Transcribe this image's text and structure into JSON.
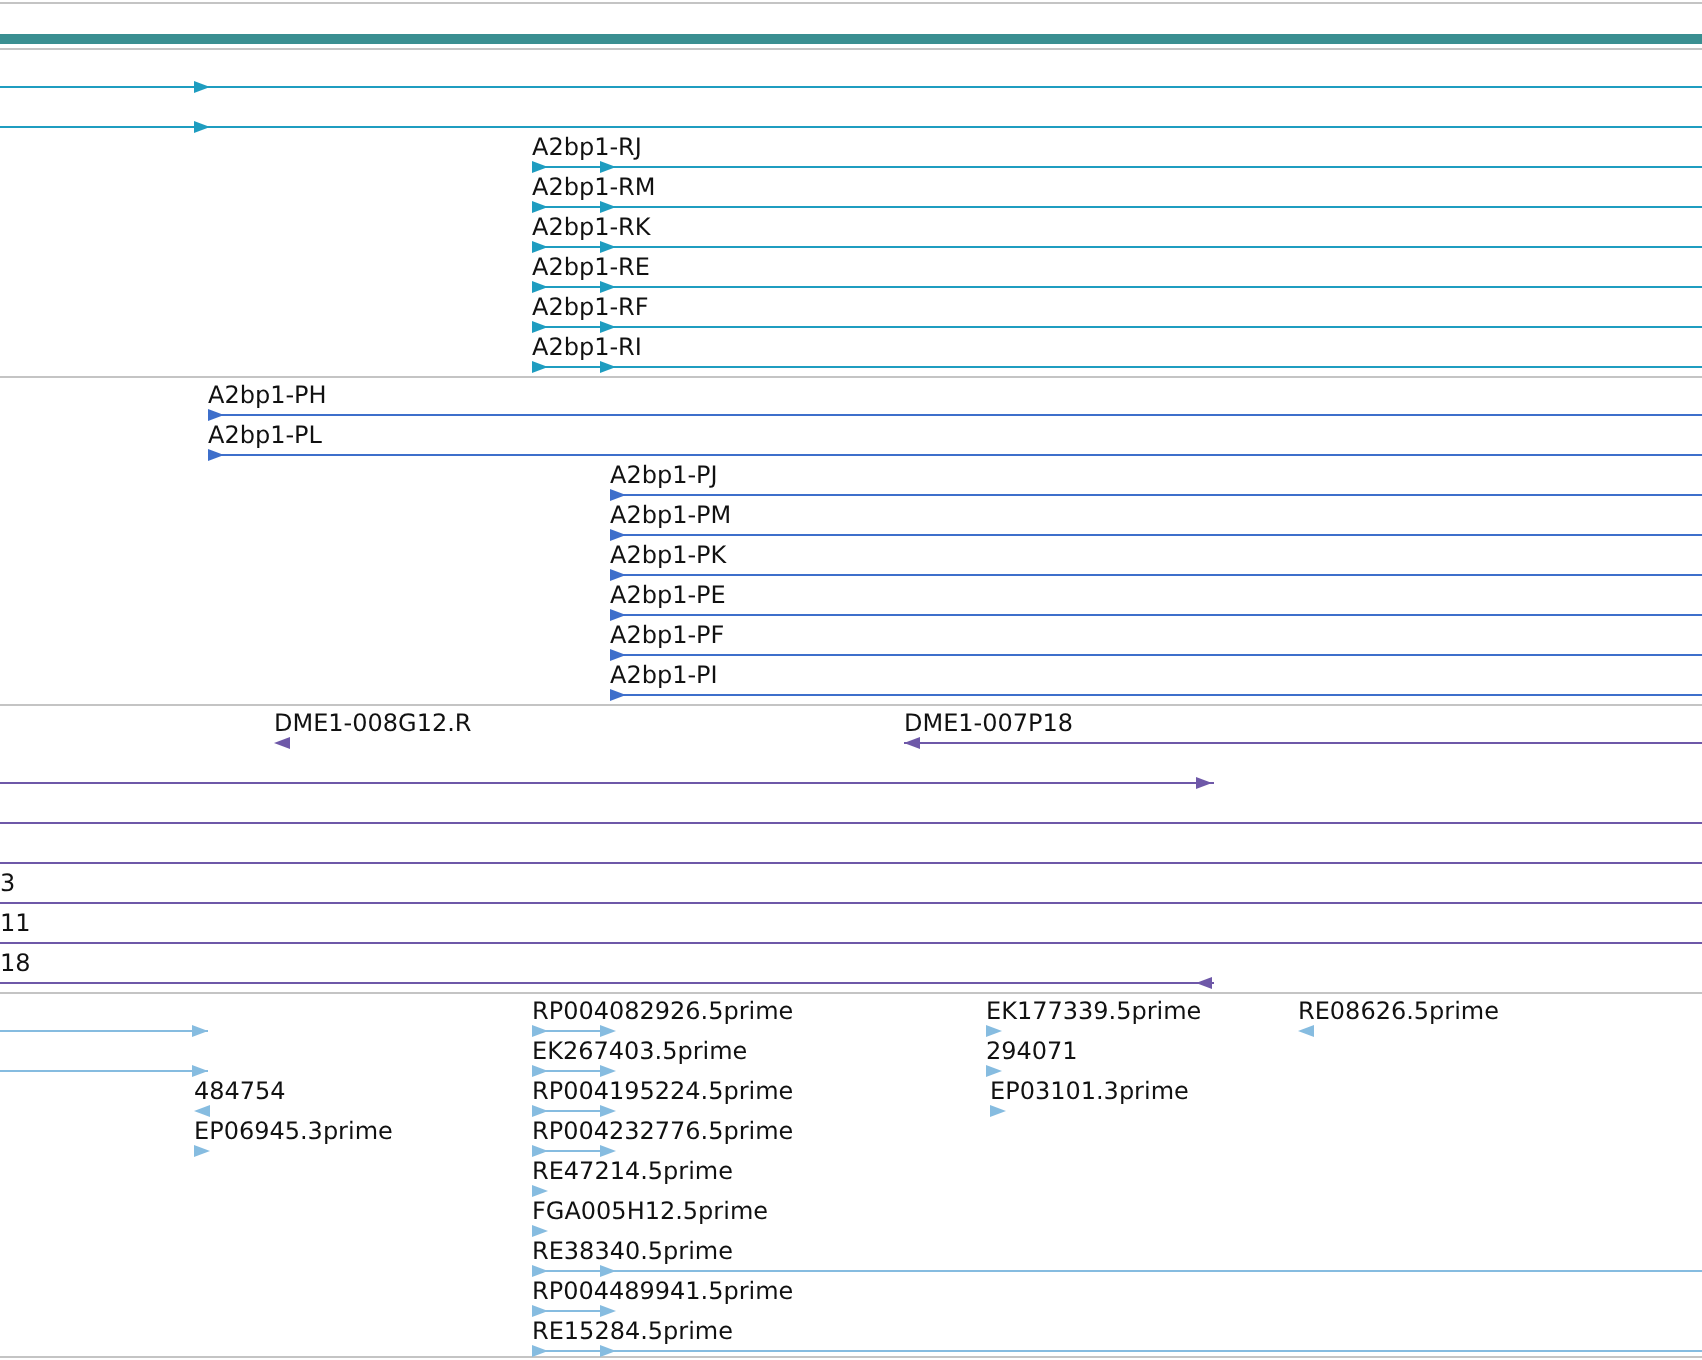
{
  "tracks": [
    {
      "color": "#1f9dc0",
      "rows": [
        {
          "features": [
            {
              "kind": "forward"
            }
          ]
        },
        {
          "features": [
            {
              "kind": "forward"
            }
          ]
        },
        {
          "features": [
            {
              "label": "A2bp1-RJ",
              "kind": "forward"
            }
          ]
        },
        {
          "features": [
            {
              "label": "A2bp1-RM",
              "kind": "forward"
            }
          ]
        },
        {
          "features": [
            {
              "label": "A2bp1-RK",
              "kind": "forward"
            }
          ]
        },
        {
          "features": [
            {
              "label": "A2bp1-RE",
              "kind": "forward"
            }
          ]
        },
        {
          "features": [
            {
              "label": "A2bp1-RF",
              "kind": "forward"
            }
          ]
        },
        {
          "features": [
            {
              "label": "A2bp1-RI",
              "kind": "forward"
            }
          ]
        }
      ]
    },
    {
      "color": "#3e6fcb",
      "rows": [
        {
          "features": [
            {
              "label": "A2bp1-PH",
              "kind": "forward"
            }
          ]
        },
        {
          "features": [
            {
              "label": "A2bp1-PL",
              "kind": "forward"
            }
          ]
        },
        {
          "features": [
            {
              "label": "A2bp1-PJ",
              "kind": "forward"
            }
          ]
        },
        {
          "features": [
            {
              "label": "A2bp1-PM",
              "kind": "forward"
            }
          ]
        },
        {
          "features": [
            {
              "label": "A2bp1-PK",
              "kind": "forward"
            }
          ]
        },
        {
          "features": [
            {
              "label": "A2bp1-PE",
              "kind": "forward"
            }
          ]
        },
        {
          "features": [
            {
              "label": "A2bp1-PF",
              "kind": "forward"
            }
          ]
        },
        {
          "features": [
            {
              "label": "A2bp1-PI",
              "kind": "forward"
            }
          ]
        }
      ]
    },
    {
      "color": "#6e58a8",
      "rows": [
        {
          "features": [
            {
              "label": "DME1-008G12.R",
              "kind": "reverse"
            },
            {
              "label": "DME1-007P18",
              "kind": "reverse"
            }
          ]
        },
        {
          "features": [
            {
              "kind": "forward"
            }
          ]
        },
        {
          "features": [
            {
              "kind": "plain"
            }
          ]
        },
        {
          "features": [
            {
              "kind": "plain"
            }
          ]
        },
        {
          "features": [
            {
              "label": "3",
              "kind": "plain"
            }
          ]
        },
        {
          "features": [
            {
              "label": "11",
              "kind": "plain"
            }
          ]
        },
        {
          "features": [
            {
              "label": "18",
              "kind": "reverse"
            }
          ]
        }
      ]
    },
    {
      "color": "#86bce0",
      "rows": [
        {
          "features": [
            {
              "kind": "forward"
            },
            {
              "label": "RP004082926.5prime",
              "kind": "forward"
            },
            {
              "label": "EK177339.5prime",
              "kind": "forward"
            },
            {
              "label": "RE08626.5prime",
              "kind": "reverse"
            }
          ]
        },
        {
          "features": [
            {
              "kind": "forward"
            },
            {
              "label": "EK267403.5prime",
              "kind": "forward"
            },
            {
              "label": "294071",
              "kind": "forward"
            }
          ]
        },
        {
          "features": [
            {
              "label": "484754",
              "kind": "reverse"
            },
            {
              "label": "RP004195224.5prime",
              "kind": "forward"
            },
            {
              "label": "EP03101.3prime",
              "kind": "forward"
            }
          ]
        },
        {
          "features": [
            {
              "label": "EP06945.3prime",
              "kind": "forward"
            },
            {
              "label": "RP004232776.5prime",
              "kind": "forward"
            }
          ]
        },
        {
          "features": [
            {
              "label": "RE47214.5prime",
              "kind": "forward"
            }
          ]
        },
        {
          "features": [
            {
              "label": "FGA005H12.5prime",
              "kind": "forward"
            }
          ]
        },
        {
          "features": [
            {
              "label": "RE38340.5prime",
              "kind": "forward"
            }
          ]
        },
        {
          "features": [
            {
              "label": "RP004489941.5prime",
              "kind": "forward"
            }
          ]
        },
        {
          "features": [
            {
              "label": "RE15284.5prime",
              "kind": "forward"
            }
          ]
        }
      ]
    }
  ]
}
